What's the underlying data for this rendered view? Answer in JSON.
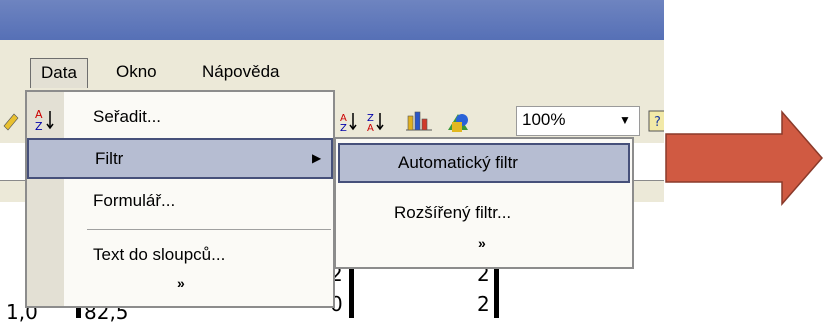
{
  "menubar": {
    "items": [
      {
        "label": "Data",
        "open": true
      },
      {
        "label": "Okno"
      },
      {
        "label": "Nápověda"
      }
    ]
  },
  "toolbar": {
    "zoom": "100%",
    "icons": [
      "sort-ascending-icon",
      "sort-descending-icon",
      "chart-icon",
      "drawing-icon",
      "help-icon"
    ]
  },
  "data_menu": {
    "items": [
      {
        "label": "Seřadit...",
        "icon": "sort-az-icon"
      },
      {
        "label": "Filtr",
        "submenu": true,
        "highlighted": true
      },
      {
        "label": "Formulář..."
      },
      {
        "label": "Text do sloupců..."
      }
    ],
    "expand_glyph": "»"
  },
  "filter_submenu": {
    "items": [
      {
        "label": "Automatický filtr",
        "highlighted": true
      },
      {
        "label": "Rozšířený filtr..."
      }
    ],
    "expand_glyph": "»"
  },
  "sheet": {
    "cells": [
      "2",
      "2",
      "0",
      "2",
      "82,5",
      "1,0"
    ]
  },
  "colors": {
    "title_bar": "#5670b6",
    "highlight": "#b6bdd2",
    "arrow_fill": "#d05a42"
  }
}
